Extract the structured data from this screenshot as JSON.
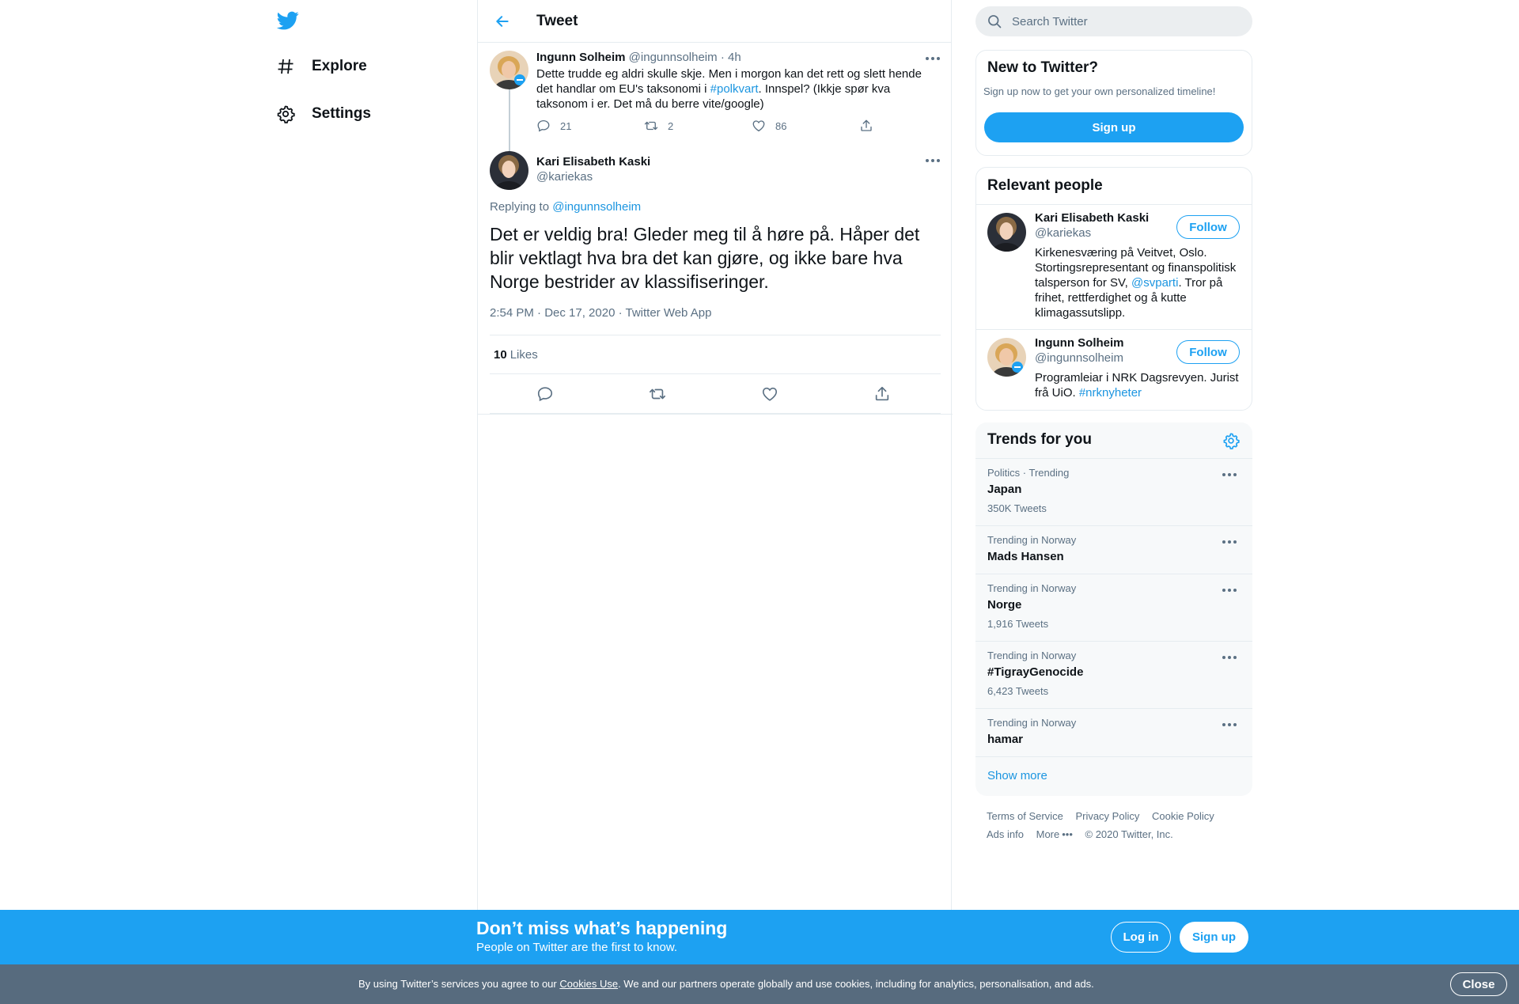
{
  "nav": {
    "logo_icon": "twitter-bird-icon",
    "items": [
      {
        "label": "Explore",
        "icon": "hashtag-icon"
      },
      {
        "label": "Settings",
        "icon": "gear-icon"
      }
    ]
  },
  "header": {
    "title": "Tweet",
    "back_icon": "arrow-left-icon"
  },
  "parent_tweet": {
    "name": "Ingunn Solheim",
    "handle": "@ingunnsolheim",
    "separator": "·",
    "time": "4h",
    "text_before": "Dette trudde eg aldri skulle skje. Men i morgon kan det rett og slett hende det handlar om EU's taksonomi i ",
    "hashtag": "#polkvart",
    "text_after": ". Innspel? (Ikkje spør kva taksonom i er. Det må du berre vite/google)",
    "replies": "21",
    "retweets": "2",
    "likes": "86"
  },
  "main_tweet": {
    "name": "Kari Elisabeth Kaski",
    "handle": "@kariekas",
    "replying_label": "Replying to",
    "replying_to": "@ingunnsolheim",
    "text": "Det er veldig bra! Gleder meg til å høre på. Håper det blir vektlagt hva bra det kan gjøre, og ikke bare hva Norge bestrider av klassifiseringer.",
    "meta": "2:54 PM · Dec 17, 2020 · Twitter Web App",
    "likes_count": "10",
    "likes_label": "Likes"
  },
  "search": {
    "placeholder": "Search Twitter"
  },
  "new_to_twitter": {
    "title": "New to Twitter?",
    "subtitle": "Sign up now to get your own personalized timeline!",
    "button": "Sign up"
  },
  "relevant_people": {
    "title": "Relevant people",
    "people": [
      {
        "name": "Kari Elisabeth Kaski",
        "handle": "@kariekas",
        "bio_before": "Kirkenesværing på Veitvet, Oslo. Stortingsrepresentant og finanspolitisk talsperson for SV, ",
        "bio_link": "@svparti",
        "bio_after": ". Tror på frihet, rettferdighet og å kutte klimagassutslipp.",
        "follow": "Follow"
      },
      {
        "name": "Ingunn Solheim",
        "handle": "@ingunnsolheim",
        "bio_before": "Programleiar i NRK Dagsrevyen. Jurist frå UiO. ",
        "bio_link": "#nrknyheter",
        "bio_after": "",
        "follow": "Follow"
      }
    ]
  },
  "trends": {
    "title": "Trends for you",
    "items": [
      {
        "context": "Politics · Trending",
        "name": "Japan",
        "count": "350K Tweets"
      },
      {
        "context": "Trending in Norway",
        "name": "Mads Hansen",
        "count": ""
      },
      {
        "context": "Trending in Norway",
        "name": "Norge",
        "count": "1,916 Tweets"
      },
      {
        "context": "Trending in Norway",
        "name": "#TigrayGenocide",
        "count": "6,423 Tweets"
      },
      {
        "context": "Trending in Norway",
        "name": "hamar",
        "count": ""
      }
    ],
    "show_more": "Show more"
  },
  "footer": {
    "terms": "Terms of Service",
    "privacy": "Privacy Policy",
    "cookie": "Cookie Policy",
    "ads": "Ads info",
    "more": "More",
    "copyright": "© 2020 Twitter, Inc."
  },
  "bottom_bar": {
    "title": "Don’t miss what’s happening",
    "subtitle": "People on Twitter are the first to know.",
    "login": "Log in",
    "signup": "Sign up"
  },
  "cookie_bar": {
    "text_before": "By using Twitter’s services you agree to our ",
    "link": "Cookies Use",
    "text_after": ". We and our partners operate globally and use cookies, including for analytics, personalisation, and ads.",
    "close": "Close"
  },
  "colors": {
    "accent": "#1da1f2",
    "link": "#1b95e0",
    "muted": "#5b7083",
    "cookie_bg": "#576b7e"
  }
}
